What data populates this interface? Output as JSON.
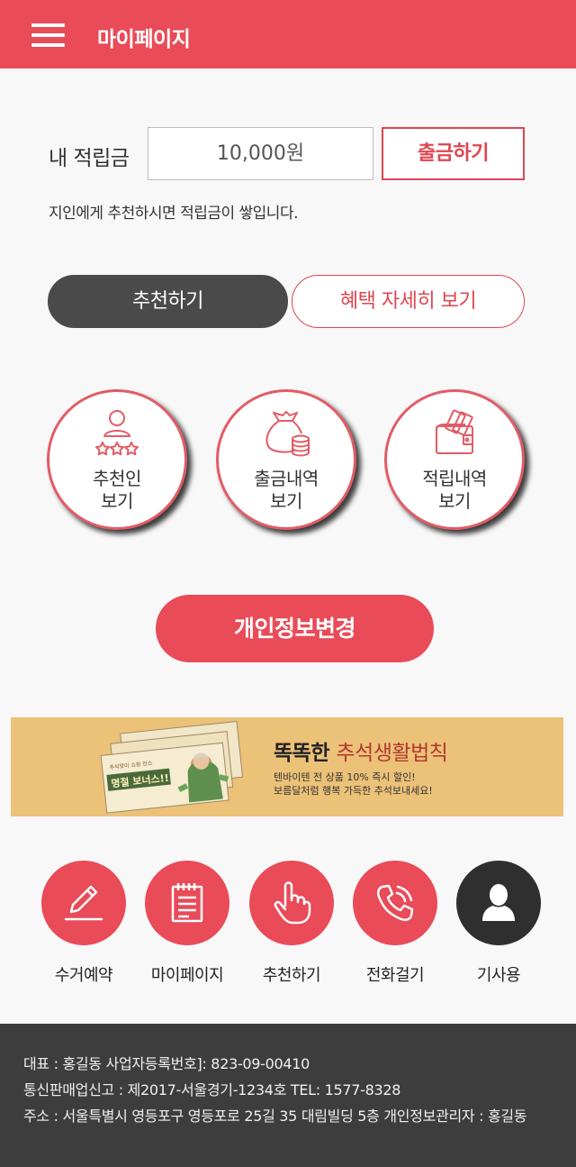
{
  "header": {
    "title": "마이페이지",
    "menu_icon": "hamburger-menu-icon",
    "bg_color": "#e94b58"
  },
  "points": {
    "label": "내 적립금",
    "value": "10,000원",
    "withdraw_label": "출금하기",
    "notice": "지인에게 추천하시면 적립금이 쌓입니다."
  },
  "actions": {
    "recommend_label": "추천하기",
    "benefits_label": "혜택 자세히 보기"
  },
  "circles": [
    {
      "icon": "person-stars-icon",
      "line1": "추천인",
      "line2": "보기"
    },
    {
      "icon": "money-bag-coins-icon",
      "line1": "출금내역",
      "line2": "보기"
    },
    {
      "icon": "wallet-cards-icon",
      "line1": "적립내역",
      "line2": "보기"
    }
  ],
  "edit_profile_label": "개인정보변경",
  "banner": {
    "title_prefix": "똑똑한",
    "title_highlight": "추석생활법칙",
    "sub1": "텐바이텐 전 상품 10% 즉시 할인!",
    "sub2": "보름달처럼 행복 가득한 추석보내세요!",
    "card_text": "명절 보너스!!",
    "card_small": "추석맞이 쇼핑 찬스"
  },
  "quick_actions": [
    {
      "icon": "pencil-icon",
      "label": "수거예약"
    },
    {
      "icon": "notepad-icon",
      "label": "마이페이지"
    },
    {
      "icon": "pointing-hand-icon",
      "label": "추천하기"
    },
    {
      "icon": "phone-call-icon",
      "label": "전화걸기"
    },
    {
      "icon": "user-icon",
      "label": "기사용"
    }
  ],
  "footer": {
    "line1": "대표 : 홍길동   사업자등록번호]: 823-09-00410",
    "line2": "통신판매업신고 : 제2017-서울경기-1234호  TEL: 1577-8328",
    "line3": "주소 : 서울특별시 영등포구 영등포로 25길 35 대림빌딩 5층  개인정보관리자 : 홍길동"
  }
}
